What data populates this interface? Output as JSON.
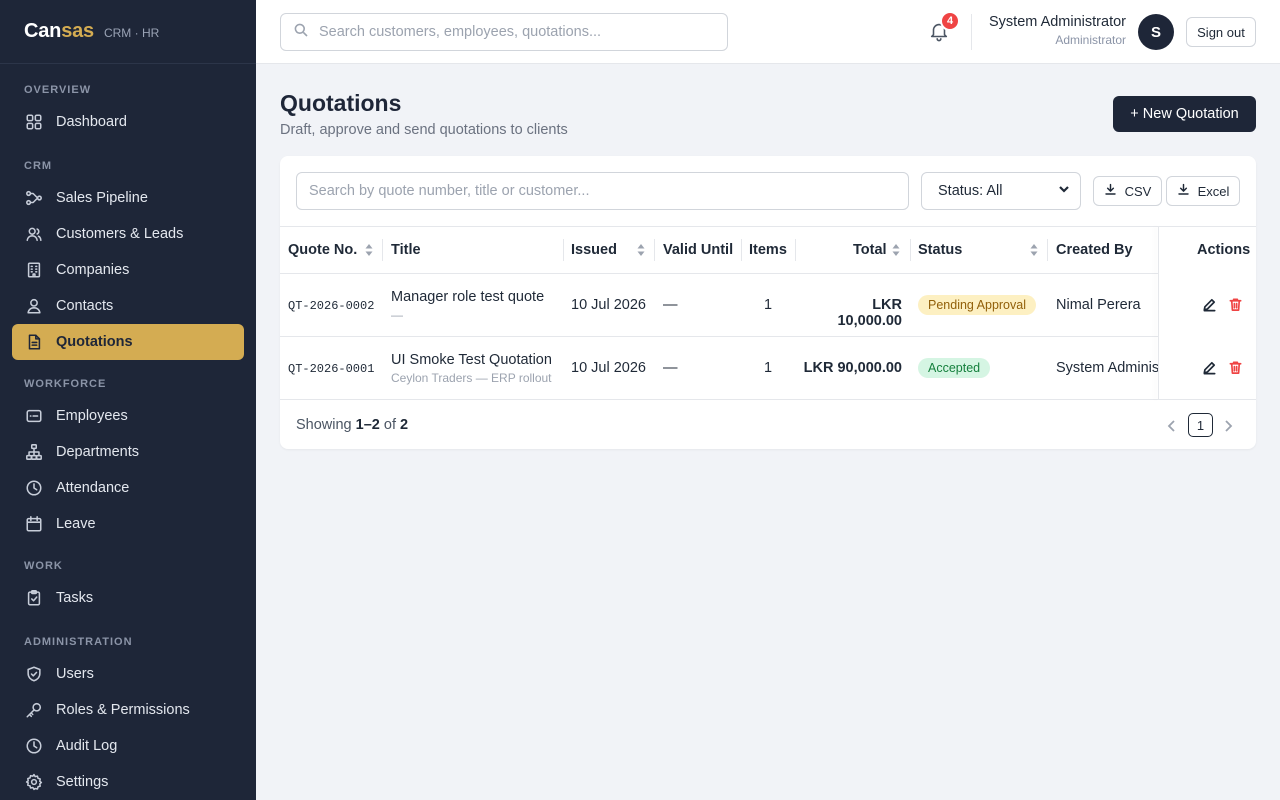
{
  "brand": {
    "name_main": "Can",
    "name_accent": "sas",
    "subtitle": "CRM · HR"
  },
  "sidebar": {
    "sections": [
      {
        "label": "OVERVIEW",
        "items": [
          {
            "label": "Dashboard",
            "icon": "grid-icon"
          }
        ]
      },
      {
        "label": "CRM",
        "items": [
          {
            "label": "Sales Pipeline",
            "icon": "pipeline-icon"
          },
          {
            "label": "Customers & Leads",
            "icon": "users-icon"
          },
          {
            "label": "Companies",
            "icon": "building-icon"
          },
          {
            "label": "Contacts",
            "icon": "user-icon"
          },
          {
            "label": "Quotations",
            "icon": "document-icon",
            "active": true
          }
        ]
      },
      {
        "label": "WORKFORCE",
        "items": [
          {
            "label": "Employees",
            "icon": "id-card-icon"
          },
          {
            "label": "Departments",
            "icon": "org-chart-icon"
          },
          {
            "label": "Attendance",
            "icon": "clock-icon"
          },
          {
            "label": "Leave",
            "icon": "calendar-icon"
          }
        ]
      },
      {
        "label": "WORK",
        "items": [
          {
            "label": "Tasks",
            "icon": "clipboard-icon"
          }
        ]
      },
      {
        "label": "ADMINISTRATION",
        "items": [
          {
            "label": "Users",
            "icon": "shield-icon"
          },
          {
            "label": "Roles & Permissions",
            "icon": "key-icon"
          },
          {
            "label": "Audit Log",
            "icon": "clock-icon"
          },
          {
            "label": "Settings",
            "icon": "gear-icon"
          }
        ]
      }
    ]
  },
  "topbar": {
    "search_placeholder": "Search customers, employees, quotations...",
    "notification_count": "4",
    "user_name": "System Administrator",
    "user_role": "Administrator",
    "avatar_initial": "S",
    "signout_label": "Sign out"
  },
  "page": {
    "title": "Quotations",
    "subtitle": "Draft, approve and send quotations to clients",
    "new_button": "+ New Quotation"
  },
  "filters": {
    "search_placeholder": "Search by quote number, title or customer...",
    "status_value": "Status: All",
    "csv_label": "CSV",
    "excel_label": "Excel"
  },
  "table": {
    "headers": {
      "quote_no": "Quote No.",
      "title": "Title",
      "issued": "Issued",
      "valid_until": "Valid Until",
      "items": "Items",
      "total": "Total",
      "status": "Status",
      "created_by": "Created By",
      "actions": "Actions"
    },
    "rows": [
      {
        "quote_no": "QT-2026-0002",
        "title": "Manager role test quote",
        "subtitle": "—",
        "issued": "10 Jul 2026",
        "valid_until": "—",
        "items": "1",
        "total": "LKR 10,000.00",
        "status": "Pending Approval",
        "status_bg": "#fdf0c2",
        "status_fg": "#92600a",
        "created_by": "Nimal Perera"
      },
      {
        "quote_no": "QT-2026-0001",
        "title": "UI Smoke Test Quotation",
        "subtitle": "Ceylon Traders — ERP rollout",
        "issued": "10 Jul 2026",
        "valid_until": "—",
        "items": "1",
        "total": "LKR 90,000.00",
        "status": "Accepted",
        "status_bg": "#d5f5e3",
        "status_fg": "#15803d",
        "created_by": "System Administrator"
      }
    ]
  },
  "footer": {
    "showing_prefix": "Showing",
    "range": "1–2",
    "of_word": "of",
    "total": "2",
    "current_page": "1"
  },
  "colors": {
    "sidebar_bg": "#1e2638",
    "accent": "#d4ac52",
    "danger": "#ef4444"
  }
}
